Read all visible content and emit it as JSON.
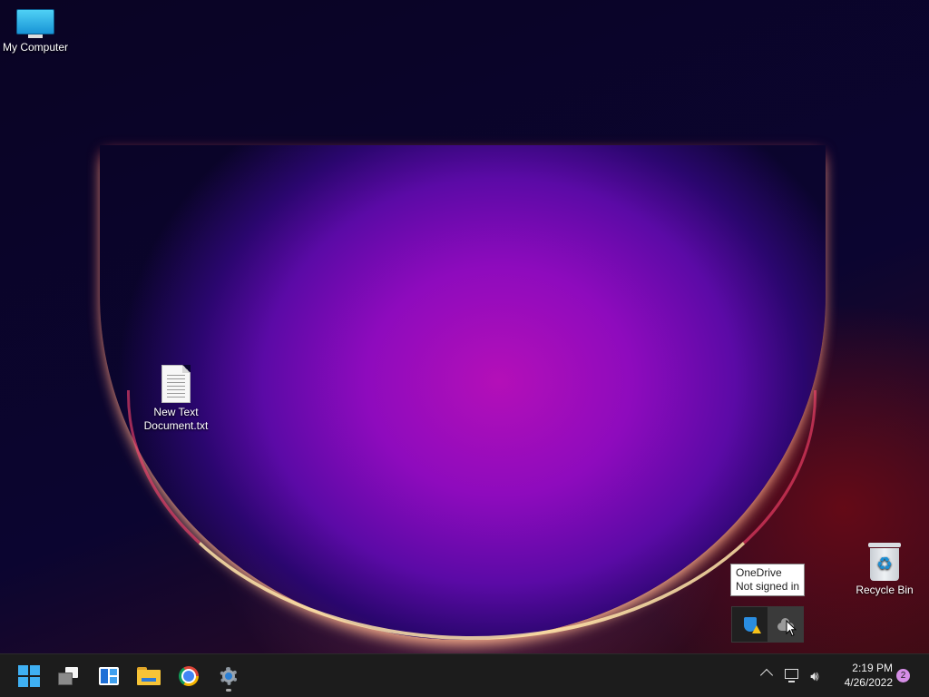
{
  "desktop": {
    "icons": [
      {
        "label": "My Computer",
        "icon": "monitor-icon"
      },
      {
        "label": "New Text Document.txt",
        "label_lines": [
          "New Text",
          "Document.txt"
        ],
        "icon": "text-file-icon"
      },
      {
        "label": "Recycle Bin",
        "icon": "recycle-bin-icon"
      }
    ]
  },
  "tooltip": {
    "lines": [
      "OneDrive",
      "Not signed in"
    ]
  },
  "tray_overflow": {
    "items": [
      {
        "icon": "windows-security-warning-icon"
      },
      {
        "icon": "onedrive-cloud-icon"
      }
    ]
  },
  "taskbar": {
    "apps": [
      {
        "icon": "start-windows-icon"
      },
      {
        "icon": "task-view-icon"
      },
      {
        "icon": "widgets-icon"
      },
      {
        "icon": "file-explorer-folder-icon"
      },
      {
        "icon": "chrome-icon"
      },
      {
        "icon": "settings-gear-icon",
        "running": true
      }
    ],
    "system_tray": {
      "icons": [
        "show-hidden-icons-chevron-icon",
        "network-icon",
        "volume-icon"
      ]
    },
    "clock": {
      "time": "2:19 PM",
      "date": "4/26/2022"
    },
    "notifications": {
      "count": "2"
    }
  },
  "colors": {
    "accent": "#3fb0f3",
    "taskbar_bg": "#1c1c1c",
    "notif_badge": "#d58ee6"
  }
}
